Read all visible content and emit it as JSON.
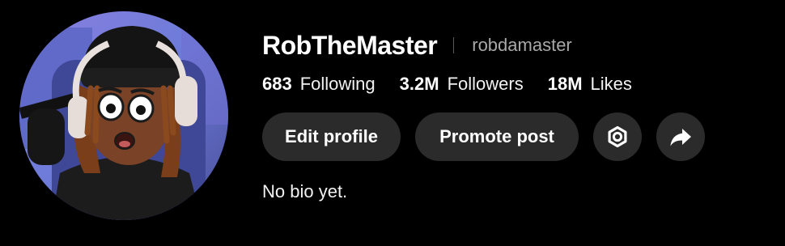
{
  "profile": {
    "display_name": "RobTheMaster",
    "username": "robdamaster",
    "bio": "No bio yet.",
    "avatar_icon": "cartoon-avatar-with-headphones"
  },
  "stats": [
    {
      "value": "683",
      "label": "Following"
    },
    {
      "value": "3.2M",
      "label": "Followers"
    },
    {
      "value": "18M",
      "label": "Likes"
    }
  ],
  "actions": {
    "edit_label": "Edit profile",
    "promote_label": "Promote post",
    "settings_icon": "gear-icon",
    "share_icon": "share-arrow-icon"
  },
  "colors": {
    "background": "#000000",
    "button_bg": "#2b2b2b",
    "text_primary": "#ffffff",
    "text_secondary": "#a8a8a8"
  }
}
